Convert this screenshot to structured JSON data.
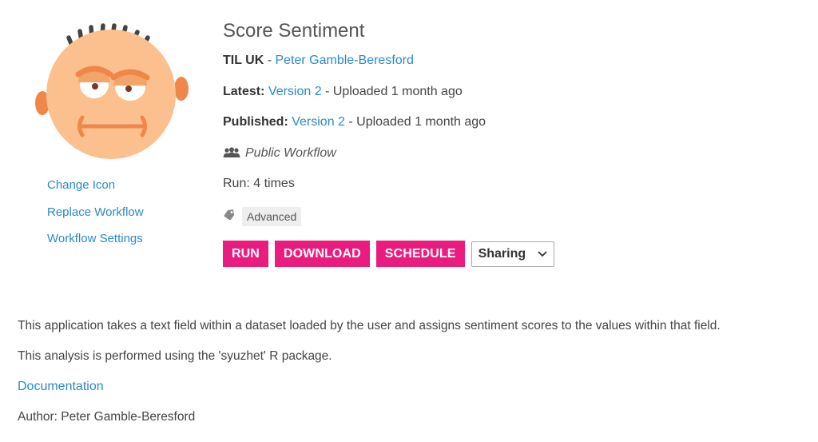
{
  "workflow": {
    "title": "Score Sentiment",
    "org": "TIL UK",
    "owner": "Peter Gamble-Beresford",
    "latest_label": "Latest:",
    "latest_version": "Version 2",
    "latest_uploaded": "Uploaded 1 month ago",
    "published_label": "Published:",
    "published_version": "Version 2",
    "published_uploaded": "Uploaded 1 month ago",
    "visibility": "Public Workflow",
    "run_count": "Run: 4 times",
    "tag": "Advanced",
    "separator": " - "
  },
  "sidebar": {
    "links": [
      "Change Icon",
      "Replace Workflow",
      "Workflow Settings"
    ]
  },
  "actions": {
    "run": "RUN",
    "download": "DOWNLOAD",
    "schedule": "SCHEDULE",
    "sharing_selected": "Sharing"
  },
  "description": {
    "line1": "This application takes a text field within a dataset loaded by the user and assigns sentiment scores to the values within that field.",
    "line2": "This analysis is performed using the 'syuzhet' R package.",
    "doc_link": "Documentation",
    "author": "Author: Peter Gamble-Beresford"
  },
  "colors": {
    "accent_pink": "#ea1d7f",
    "link_blue": "#2a8ac9",
    "face": "#fbc08e"
  },
  "icons": {
    "avatar": "bald-face-avatar",
    "visibility": "users-icon",
    "tag": "tag-icon",
    "dropdown": "chevron-down-icon"
  }
}
